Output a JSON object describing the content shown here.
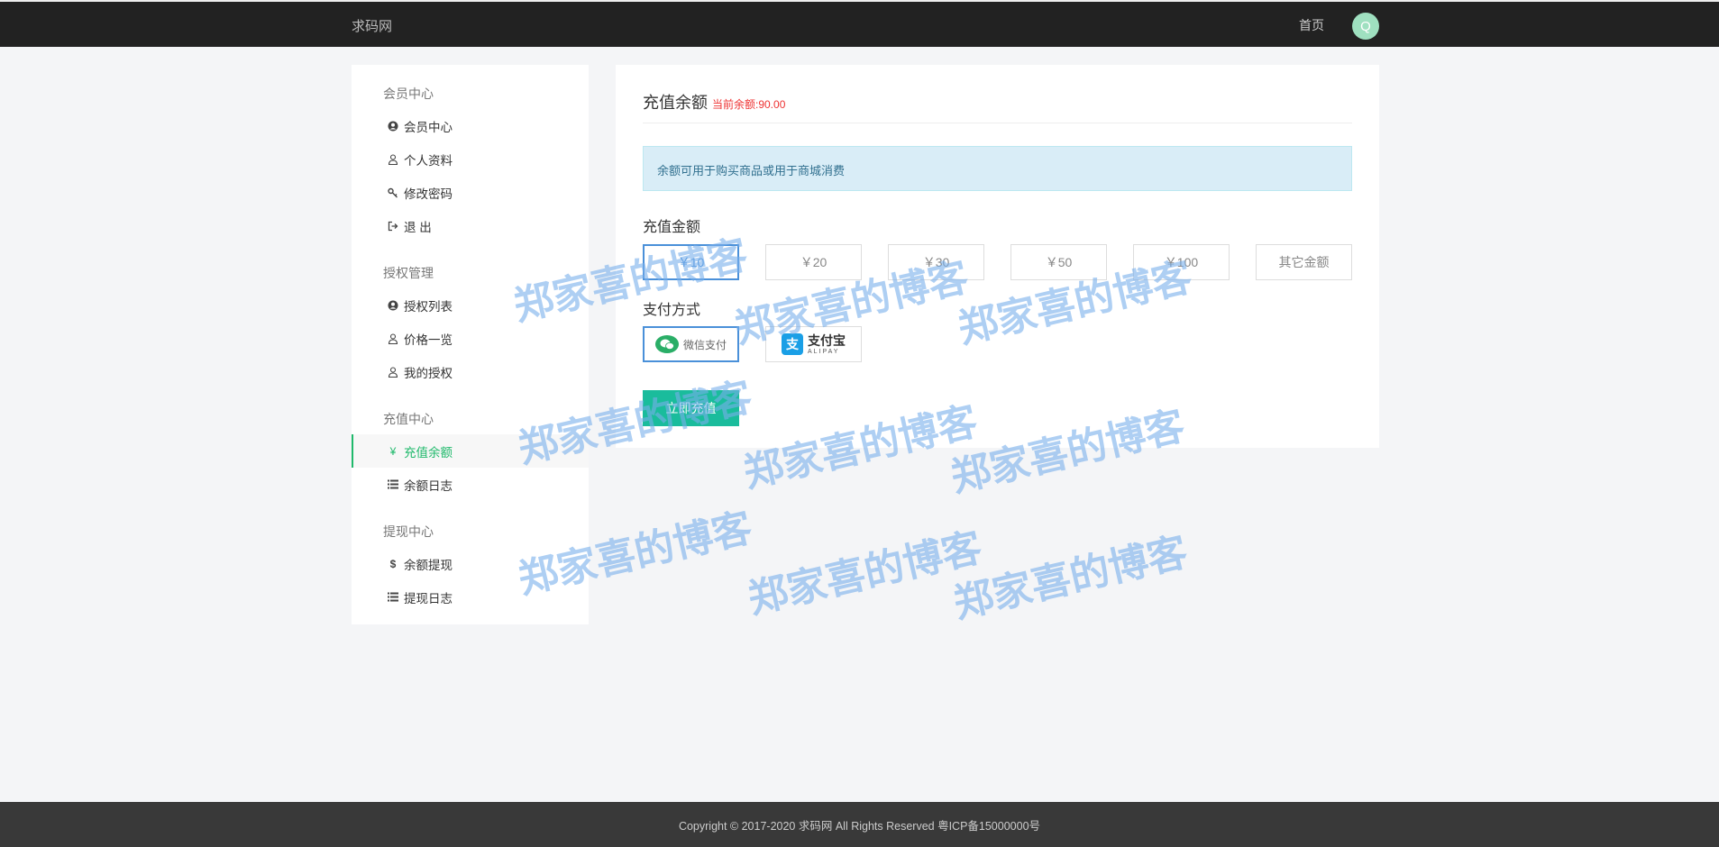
{
  "nav": {
    "brand": "求码网",
    "home": "首页",
    "avatar": "Q"
  },
  "sidebar": {
    "groups": [
      {
        "title": "会员中心",
        "items": [
          {
            "label": "会员中心",
            "icon": "user-circle-icon"
          },
          {
            "label": "个人资料",
            "icon": "user-icon"
          },
          {
            "label": "修改密码",
            "icon": "key-icon"
          },
          {
            "label": "退 出",
            "icon": "sign-out-icon"
          }
        ]
      },
      {
        "title": "授权管理",
        "items": [
          {
            "label": "授权列表",
            "icon": "user-circle-icon"
          },
          {
            "label": "价格一览",
            "icon": "user-icon"
          },
          {
            "label": "我的授权",
            "icon": "user-icon"
          }
        ]
      },
      {
        "title": "充值中心",
        "items": [
          {
            "label": "充值余额",
            "icon": "yen-icon",
            "active": true
          },
          {
            "label": "余额日志",
            "icon": "list-icon"
          }
        ]
      },
      {
        "title": "提现中心",
        "items": [
          {
            "label": "余额提现",
            "icon": "dollar-icon"
          },
          {
            "label": "提现日志",
            "icon": "list-icon"
          }
        ]
      }
    ]
  },
  "main": {
    "title": "充值余额",
    "balance": "当前余额:90.00",
    "info": "余额可用于购买商品或用于商城消费",
    "amount_label": "充值金额",
    "amounts": [
      "￥10",
      "￥20",
      "￥30",
      "￥50",
      "￥100",
      "其它金额"
    ],
    "selected_amount": "￥10",
    "pay_label": "支付方式",
    "pay_methods": {
      "wechat": "微信支付",
      "alipay_cn": "支付宝",
      "alipay_en": "ALIPAY"
    },
    "submit": "立即充值"
  },
  "watermark": "郑家喜的博客",
  "footer": "Copyright © 2017-2020 求码网 All Rights Reserved 粤ICP备15000000号",
  "colors": {
    "accent": "#1fb96b",
    "button": "#1abc9c",
    "selected": "#4a90d9",
    "balance": "#e33333"
  }
}
